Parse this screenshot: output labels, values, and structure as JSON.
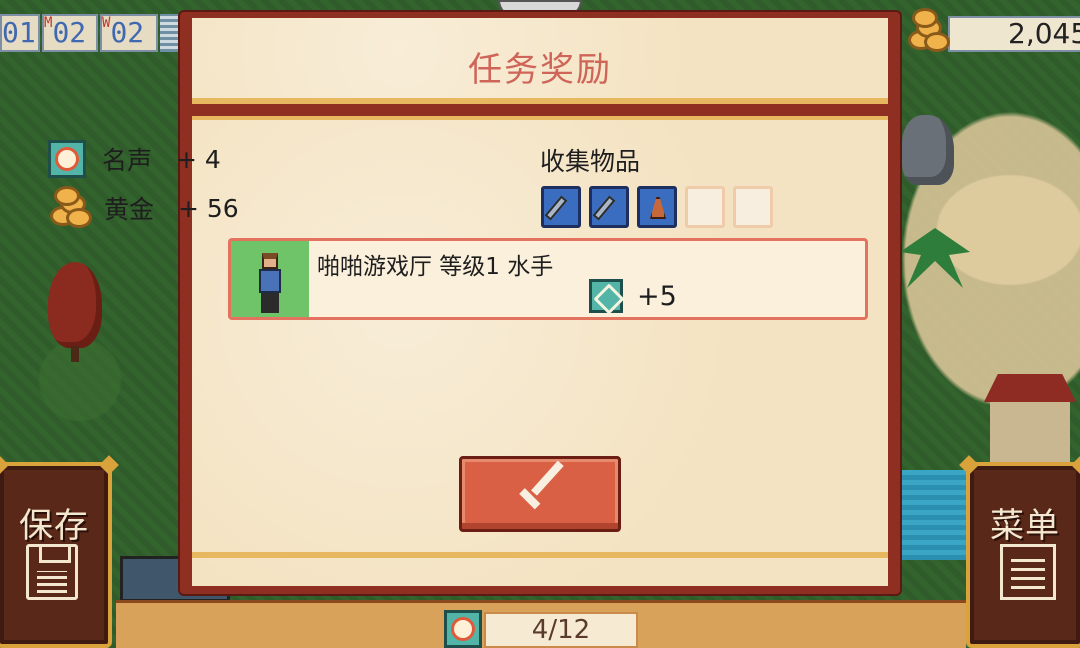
{
  "hud": {
    "day": "01",
    "month_marker": "M",
    "month": "02",
    "week_marker": "W",
    "week": "02",
    "gold": "2,045"
  },
  "side_buttons": {
    "save_label": "保存",
    "menu_label": "菜单"
  },
  "dialog": {
    "title": "任务奖励",
    "fame_label": "名声",
    "fame_value": "+ 4",
    "gold_label": "黄金",
    "gold_value": "+ 56",
    "collect_title": "收集物品",
    "collect_slots": [
      "tool",
      "tool",
      "bell",
      "empty",
      "empty"
    ],
    "character_line": "啪啪游戏厅 等级1 水手",
    "skill_gain": "+5"
  },
  "progress": {
    "text": "4/12"
  },
  "colors": {
    "title_text": "#cf6559",
    "dialog_frame": "#8e2f22",
    "parchment": "#f4e3c2",
    "confirm_button": "#d95f45",
    "slot_filled": "#3a6dbf"
  },
  "icons": [
    "fame-icon",
    "coin-stack-icon",
    "sailor-portrait-icon",
    "skill-icon",
    "check-icon",
    "floppy-disk-icon",
    "document-icon"
  ]
}
